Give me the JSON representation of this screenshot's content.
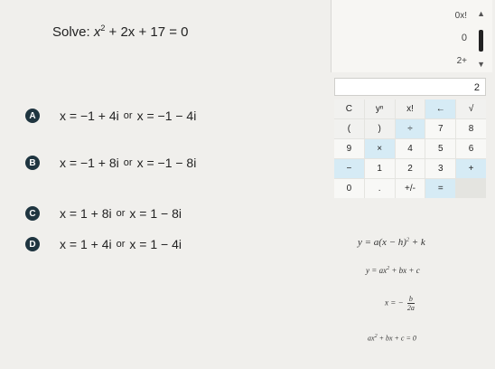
{
  "question": {
    "prefix": "Solve: ",
    "x1": "x",
    "exp": "2",
    "rest": " + 2x + 17 = 0"
  },
  "choices": [
    {
      "letter": "A",
      "left": "x = −1 + 4i",
      "or": "or",
      "right": "x = −1 − 4i"
    },
    {
      "letter": "B",
      "left": "x = −1 + 8i",
      "or": "or",
      "right": "x = −1 − 8i"
    },
    {
      "letter": "C",
      "left": "x = 1 + 8i",
      "or": "or",
      "right": "x = 1 − 8i"
    },
    {
      "letter": "D",
      "left": "x = 1 + 4i",
      "or": "or",
      "right": "x = 1 − 4i"
    }
  ],
  "calculator": {
    "history": [
      "0x!",
      "0",
      "2+"
    ],
    "entry": "2",
    "keys": [
      "C",
      "yⁿ",
      "x!",
      "←",
      "√",
      "(",
      ")",
      "÷",
      "7",
      "8",
      "9",
      "×",
      "4",
      "5",
      "6",
      "−",
      "1",
      "2",
      "3",
      "+",
      "0",
      ".",
      "+/-",
      "="
    ],
    "colors": {
      "operator_key": "#d6ebf5",
      "badge": "#1f3540"
    }
  },
  "formulas": {
    "vertex_form": {
      "main": "y = a(x − h)",
      "exp": "2",
      "tail": " + k"
    },
    "standard_form": {
      "main": "y = ax",
      "exp": "2",
      "tail": " + bx + c"
    },
    "axis": {
      "lhs": "x = −",
      "num": "b",
      "den": "2a"
    },
    "equation": {
      "main": "ax",
      "exp": "2",
      "tail": " + bx + c = 0"
    }
  }
}
